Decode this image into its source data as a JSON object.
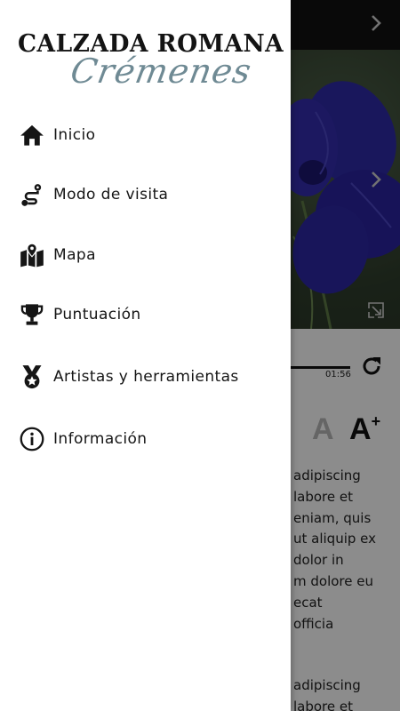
{
  "background": {
    "player_time": "01:56",
    "font_small_label": "A",
    "font_large_label": "A",
    "font_large_plus": "+",
    "text_lines": [
      "adipiscing",
      "labore et",
      "eniam, quis",
      "ut aliquip ex",
      "dolor in",
      "m dolore eu",
      "ecat",
      "officia"
    ],
    "text_lines_2": [
      "adipiscing",
      "labore et"
    ],
    "colors": {
      "topbar": "#111111",
      "flower": "#2e2aa6",
      "dim_overlay": "rgba(0,0,0,0.45)"
    }
  },
  "drawer": {
    "logo_title": "CALZADA ROMANA",
    "logo_script": "Crémenes",
    "items": [
      {
        "label": "Inicio",
        "icon": "home-icon"
      },
      {
        "label": "Modo de visita",
        "icon": "route-icon"
      },
      {
        "label": "Mapa",
        "icon": "map-pin-icon"
      },
      {
        "label": "Puntuación",
        "icon": "trophy-icon"
      },
      {
        "label": "Artistas y herramientas",
        "icon": "medal-icon"
      },
      {
        "label": "Información",
        "icon": "info-icon"
      }
    ]
  }
}
